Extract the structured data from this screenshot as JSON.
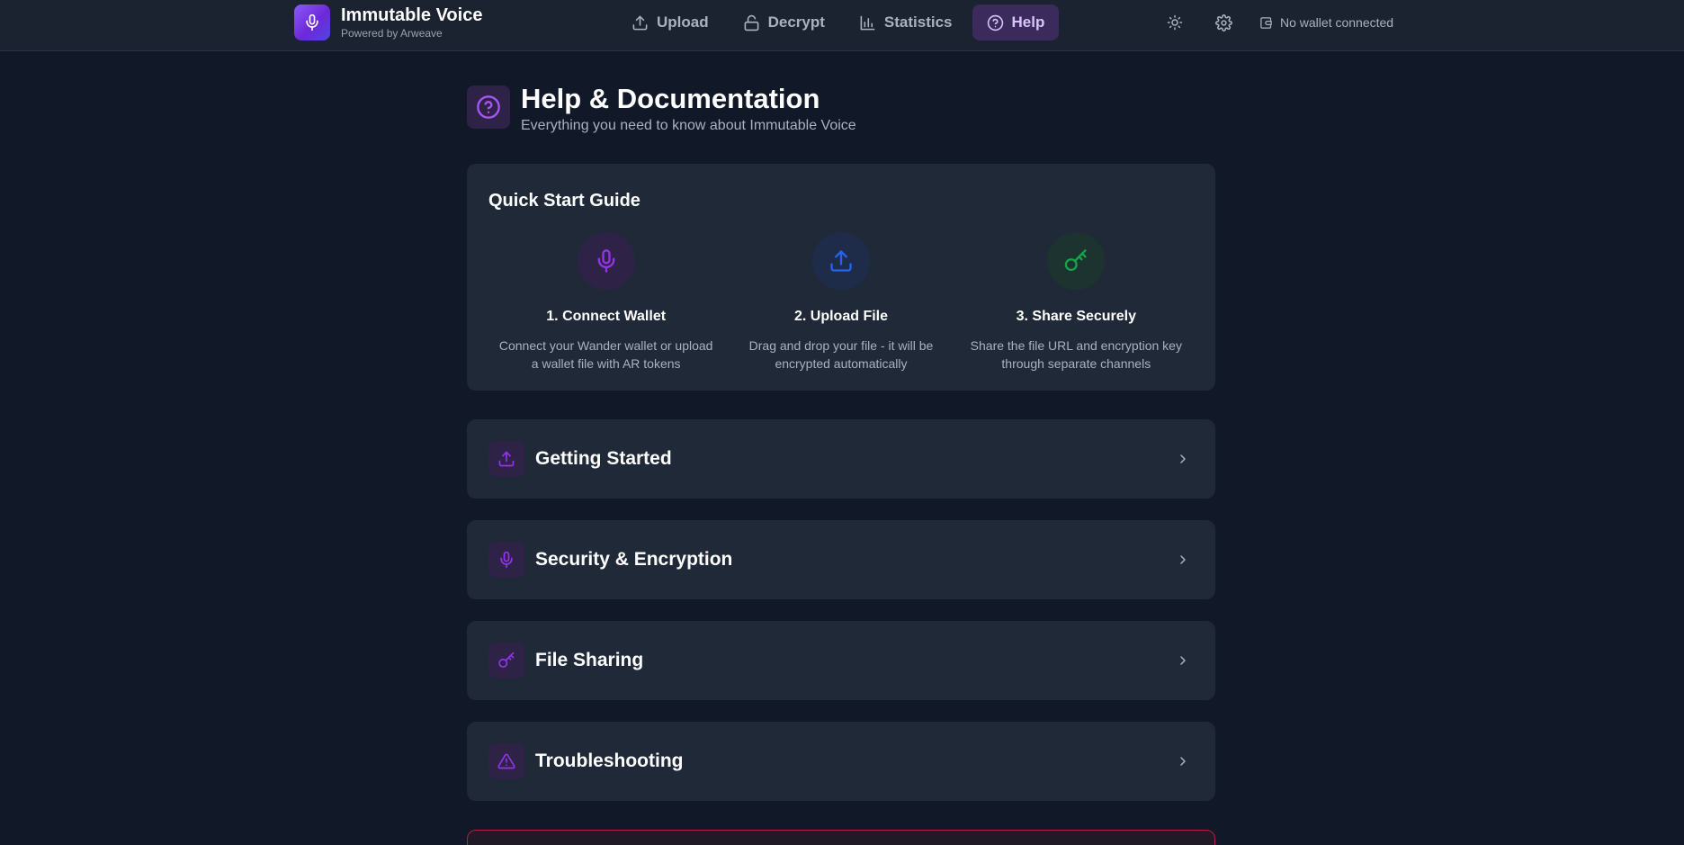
{
  "brand": {
    "title": "Immutable Voice",
    "subtitle": "Powered by Arweave",
    "logo_icon": "microphone-icon",
    "gradient": [
      "#8b5cf6",
      "#4f46e5"
    ]
  },
  "nav": {
    "items": [
      {
        "label": "Upload",
        "icon": "upload-icon",
        "active": false
      },
      {
        "label": "Decrypt",
        "icon": "unlock-icon",
        "active": false
      },
      {
        "label": "Statistics",
        "icon": "bar-chart-icon",
        "active": false
      },
      {
        "label": "Help",
        "icon": "help-circle-icon",
        "active": true
      }
    ]
  },
  "tools": {
    "theme_icon": "sun-icon",
    "settings_icon": "gear-icon",
    "wallet_icon": "wallet-icon",
    "wallet_status": "No wallet connected"
  },
  "page": {
    "title": "Help & Documentation",
    "subtitle": "Everything you need to know about Immutable Voice",
    "icon": "help-circle-icon"
  },
  "quick_start": {
    "heading": "Quick Start Guide",
    "steps": [
      {
        "title": "1. Connect Wallet",
        "desc": "Connect your Wander wallet or upload a wallet file with AR tokens",
        "icon": "microphone-icon",
        "color": "#9333ea"
      },
      {
        "title": "2. Upload File",
        "desc": "Drag and drop your file - it will be encrypted automatically",
        "icon": "upload-icon",
        "color": "#2563eb"
      },
      {
        "title": "3. Share Securely",
        "desc": "Share the file URL and encryption key through separate channels",
        "icon": "key-icon",
        "color": "#16a34a"
      }
    ]
  },
  "sections": [
    {
      "label": "Getting Started",
      "icon": "upload-icon"
    },
    {
      "label": "Security & Encryption",
      "icon": "microphone-icon"
    },
    {
      "label": "File Sharing",
      "icon": "key-icon"
    },
    {
      "label": "Troubleshooting",
      "icon": "alert-triangle-icon"
    }
  ],
  "colors": {
    "background": "#111827",
    "card": "#1f2937",
    "accent": "#9333ea",
    "active_nav_bg": "#3b2a5c",
    "alert_border": "#b91c3c"
  }
}
